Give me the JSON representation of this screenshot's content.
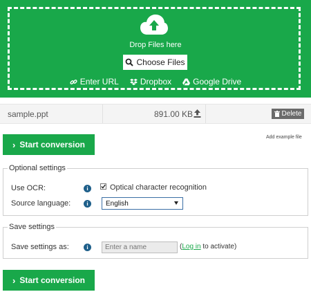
{
  "dropzone": {
    "drop_text": "Drop Files here",
    "choose_label": "Choose Files",
    "sources": [
      {
        "label": "Enter URL",
        "icon": "link-icon"
      },
      {
        "label": "Dropbox",
        "icon": "dropbox-icon"
      },
      {
        "label": "Google Drive",
        "icon": "google-drive-icon"
      }
    ]
  },
  "file": {
    "name": "sample.ppt",
    "size": "891.00 KB",
    "delete_label": "Delete"
  },
  "actions": {
    "start_label": "Start conversion",
    "add_example": "Add example file"
  },
  "optional_settings": {
    "legend": "Optional settings",
    "ocr_label": "Use OCR:",
    "ocr_checkbox_label": "Optical character recognition",
    "ocr_checked": true,
    "source_language_label": "Source language:",
    "source_language_value": "English"
  },
  "save_settings": {
    "legend": "Save settings",
    "save_as_label": "Save settings as:",
    "name_placeholder": "Enter a name",
    "activate_prefix": "(",
    "login_link": "Log in",
    "activate_suffix": " to activate)"
  },
  "colors": {
    "brand_green": "#19a84a",
    "info_blue": "#1e5f8a",
    "delete_gray": "#6b6b6b"
  }
}
